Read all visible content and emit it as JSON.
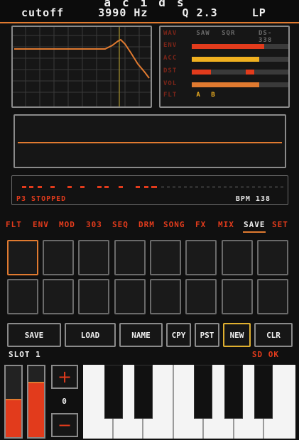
{
  "app": {
    "title": "acids"
  },
  "params": {
    "name": "cutoff",
    "value": "3990 Hz",
    "q": "Q 2.3",
    "mode": "LP"
  },
  "mixer": {
    "waves": [
      "SAW",
      "SQR"
    ],
    "wave_label": "WAV",
    "model": "DS-338",
    "rows": [
      {
        "label": "ENV",
        "level": 0.75,
        "color": "#e23b1c"
      },
      {
        "label": "ACC",
        "level": 0.7,
        "color": "#f0b020"
      },
      {
        "label": "DST",
        "level": 0.2,
        "color": "#e23b1c"
      },
      {
        "label": "VOL",
        "level": 0.7,
        "color": "#e07a30"
      }
    ],
    "flt_label": "FLT",
    "flt_options": [
      "A",
      "B"
    ]
  },
  "sequencer": {
    "status": "P3 STOPPED",
    "bpm": "BPM 138"
  },
  "tabs": [
    "FLT",
    "ENV",
    "MOD",
    "303",
    "SEQ",
    "DRM",
    "SONG",
    "FX",
    "MIX",
    "SAVE",
    "SET"
  ],
  "active_tab": "SAVE",
  "buttons": {
    "save": "SAVE",
    "load": "LOAD",
    "name": "NAME",
    "copy": "CPY",
    "paste": "PST",
    "new": "NEW",
    "clear": "CLR"
  },
  "slot": {
    "label": "SLOT  1"
  },
  "sd_status": "SD OK",
  "octave": {
    "value": "0",
    "plus": "+",
    "minus": "−"
  },
  "colors": {
    "accent": "#e07a30",
    "red": "#e23b1c",
    "yellow": "#f0b020"
  }
}
